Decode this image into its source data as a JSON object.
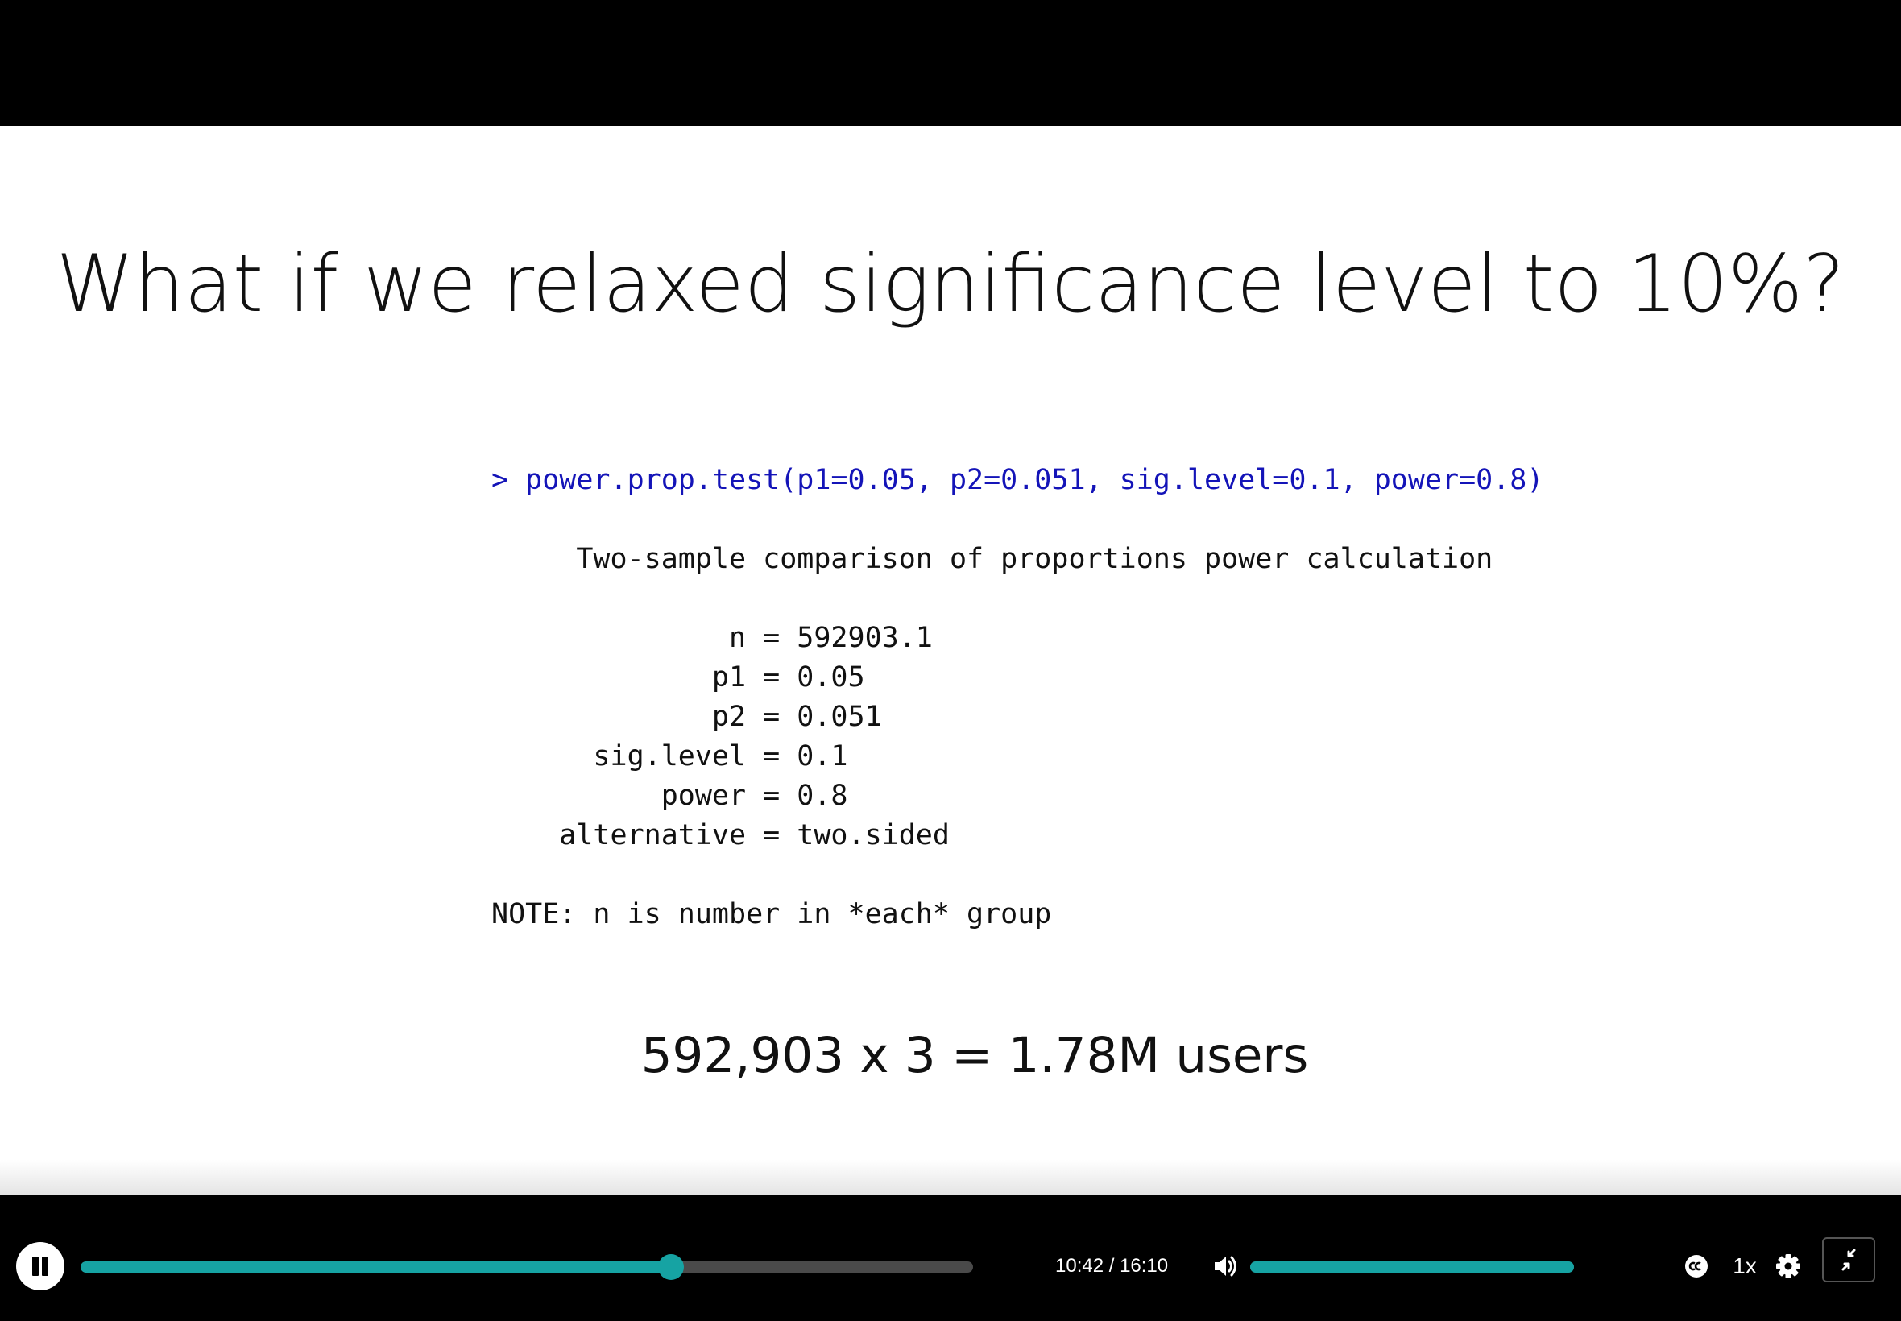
{
  "slide": {
    "title": "What if we relaxed significance level to 10%?",
    "code": {
      "command": "> power.prop.test(p1=0.05, p2=0.051, sig.level=0.1, power=0.8)",
      "heading": "     Two-sample comparison of proportions power calculation",
      "lines": [
        "              n = 592903.1",
        "             p1 = 0.05",
        "             p2 = 0.051",
        "      sig.level = 0.1",
        "          power = 0.8",
        "    alternative = two.sided"
      ],
      "note": "NOTE: n is number in *each* group"
    },
    "result": "592,903 x 3 = 1.78M users"
  },
  "player": {
    "time_display": "10:42 / 16:10",
    "progress_fraction": 0.662,
    "volume_fraction": 1.0,
    "speed_label": "1x",
    "accent_color": "#16a3a3",
    "icons": {
      "play_pause": "pause-icon",
      "volume": "volume-icon",
      "captions": "closed-captions-icon",
      "settings": "gear-icon",
      "fullscreen": "exit-fullscreen-icon"
    }
  }
}
